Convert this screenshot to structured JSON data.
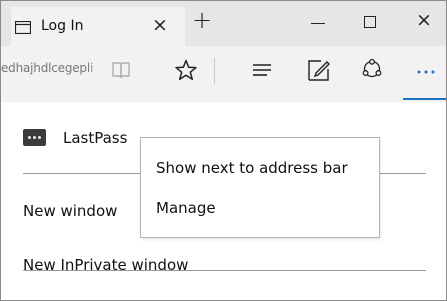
{
  "tab": {
    "title": "Log In"
  },
  "toolbar": {
    "address_text": "edhajhdlcegepli"
  },
  "menu": {
    "extension_label": "LastPass",
    "items": [
      {
        "label": "New window"
      },
      {
        "label": "New InPrivate window"
      }
    ]
  },
  "context_menu": {
    "items": [
      {
        "label": "Show next to address bar"
      },
      {
        "label": "Manage"
      }
    ]
  },
  "colors": {
    "accent": "#1e73be",
    "titlebar": "#e6e6e6",
    "toolbar": "#f2f2f2",
    "lastpass_icon": "#3b3b3b"
  },
  "icons": [
    "tab-page-icon",
    "close-icon",
    "plus-icon",
    "minimize-icon",
    "maximize-icon",
    "reading-view-icon",
    "star-icon",
    "hub-icon",
    "web-note-icon",
    "share-icon",
    "more-icon",
    "lastpass-icon"
  ]
}
